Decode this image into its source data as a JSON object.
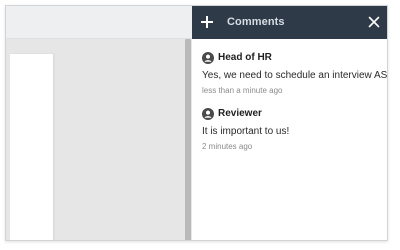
{
  "comments_panel": {
    "title": "Comments",
    "add_icon": "plus-icon",
    "close_icon": "close-icon",
    "header_color": "#2e3a48",
    "items": [
      {
        "author": "Head of HR",
        "text": "Yes, we need to schedule an interview ASAP!",
        "time": "less than a minute ago",
        "avatar_icon": "user-avatar-icon"
      },
      {
        "author": "Reviewer",
        "text": "It is important to us!",
        "time": "2 minutes ago",
        "avatar_icon": "user-avatar-icon"
      }
    ]
  }
}
